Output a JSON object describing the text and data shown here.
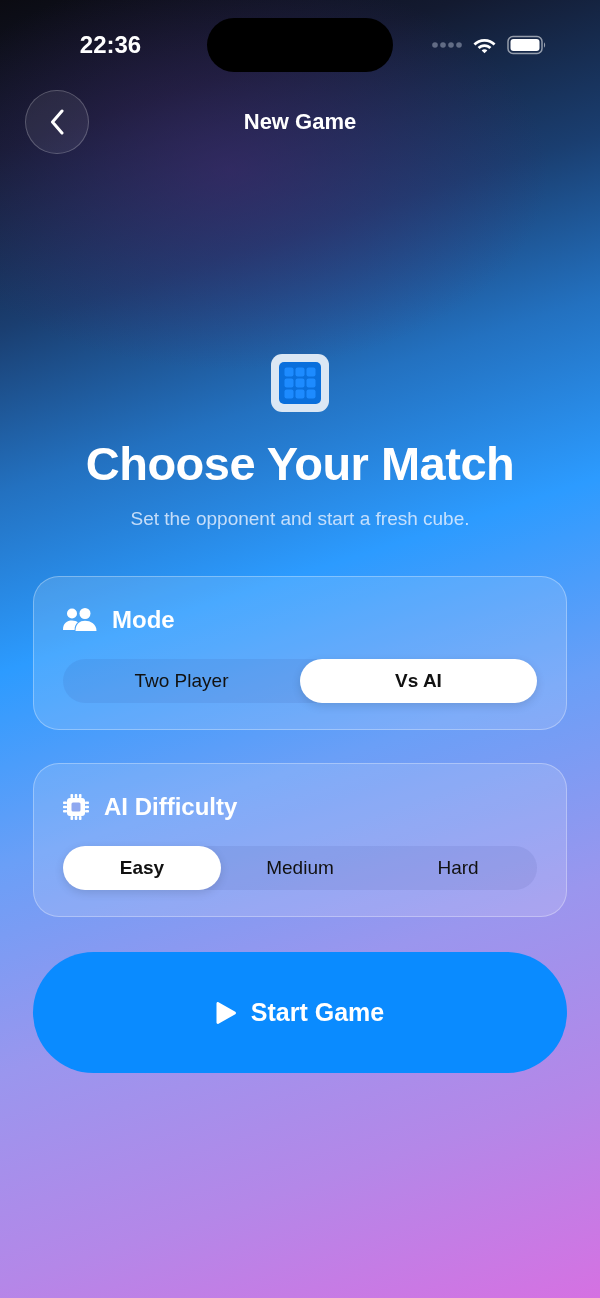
{
  "status_bar": {
    "time": "22:36"
  },
  "nav": {
    "title": "New Game"
  },
  "hero": {
    "title": "Choose Your Match",
    "subtitle": "Set the opponent and start a fresh cube."
  },
  "sections": [
    {
      "kind": "mode",
      "title": "Mode",
      "options": [
        {
          "label": "Two Player",
          "selected": false
        },
        {
          "label": "Vs AI",
          "selected": true
        }
      ]
    },
    {
      "kind": "difficulty",
      "title": "AI Difficulty",
      "options": [
        {
          "label": "Easy",
          "selected": true
        },
        {
          "label": "Medium",
          "selected": false
        },
        {
          "label": "Hard",
          "selected": false
        }
      ]
    }
  ],
  "start_button": {
    "label": "Start Game"
  }
}
